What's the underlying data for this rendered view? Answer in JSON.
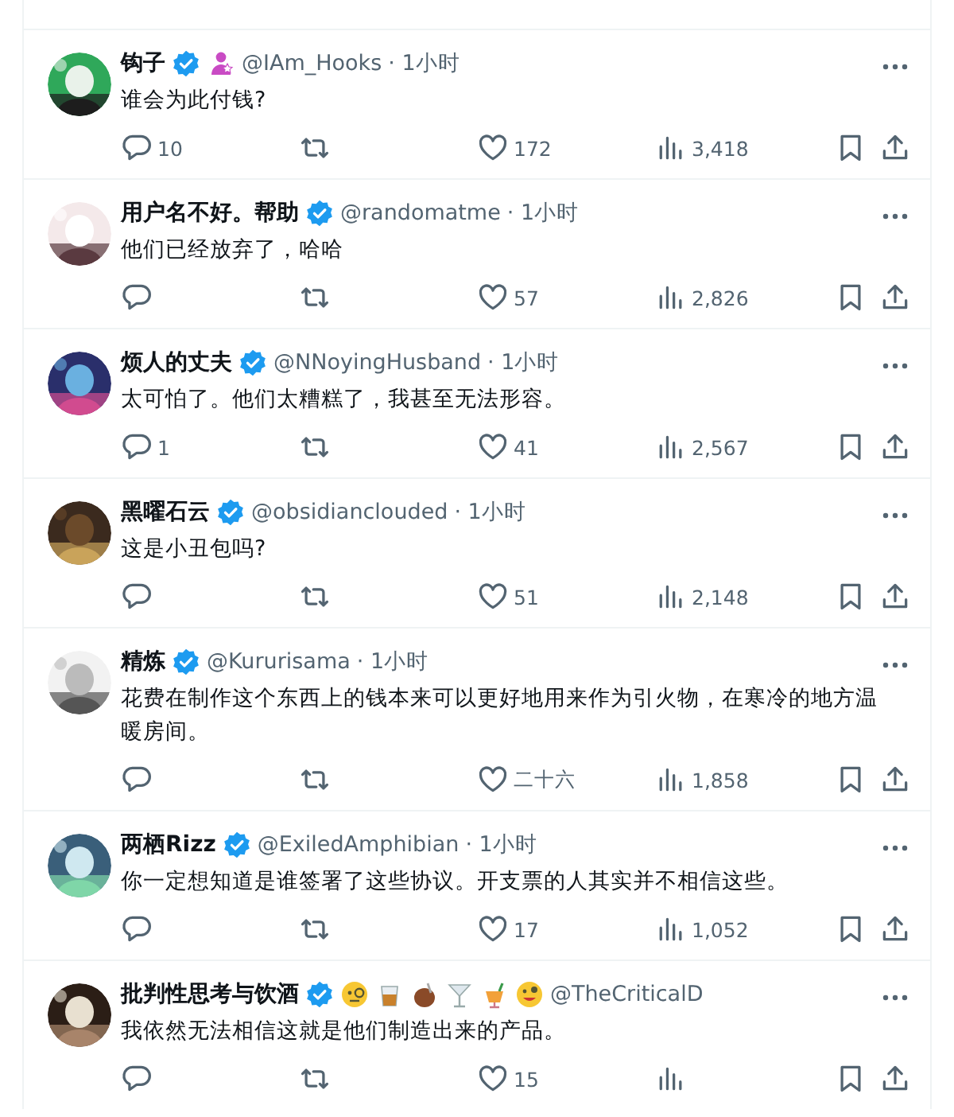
{
  "posts": [
    {
      "name": "钩子",
      "verified": true,
      "badges": [
        {
          "kind": "affiliate"
        }
      ],
      "handle": "@IAm_Hooks",
      "time": "· 1小时",
      "text": "谁会为此付钱?",
      "replies": "10",
      "likes": "172",
      "views": "3,418",
      "avatar": {
        "kind": "picture"
      }
    },
    {
      "name": "用户名不好。帮助",
      "verified": true,
      "handle": "@randomatme",
      "time": "· 1小时",
      "text": "他们已经放弃了，哈哈",
      "likes": "57",
      "views": "2,826",
      "avatar": {
        "kind": "picture"
      }
    },
    {
      "name": "烦人的丈夫",
      "verified": true,
      "handle": "@NNoyingHusband",
      "time": "· 1小时",
      "text": "太可怕了。他们太糟糕了，我甚至无法形容。",
      "replies": "1",
      "likes": "41",
      "views": "2,567",
      "avatar": {
        "kind": "picture"
      }
    },
    {
      "name": "黑曜石云",
      "verified": true,
      "handle": "@obsidianclouded",
      "time": "· 1小时",
      "text": "这是小丑包吗?",
      "likes": "51",
      "views": "2,148",
      "avatar": {
        "kind": "picture"
      }
    },
    {
      "name": "精炼",
      "verified": true,
      "handle": "@Kururisama",
      "time": "· 1小时",
      "text": "花费在制作这个东西上的钱本来可以更好地用来作为引火物，在寒冷的地方温暖房间。",
      "likes": "二十六",
      "views": "1,858",
      "avatar": {
        "kind": "picture"
      }
    },
    {
      "name": "两栖Rizz",
      "verified": true,
      "handle": "@ExiledAmphibian",
      "time": "· 1小时",
      "text": "你一定想知道是谁签署了这些协议。开支票的人其实并不相信这些。",
      "likes": "17",
      "views": "1,052",
      "avatar": {
        "kind": "picture"
      }
    },
    {
      "name": "批判性思考与饮酒",
      "verified": true,
      "badges": [
        {
          "kind": "monocle-face"
        },
        {
          "kind": "whisky-glass"
        },
        {
          "kind": "gourd-cup"
        },
        {
          "kind": "cocktail-glass"
        },
        {
          "kind": "tropical-drink"
        },
        {
          "kind": "zany-face"
        }
      ],
      "handle": "@TheCriticalD",
      "text": "我依然无法相信这就是他们制造出来的产品。",
      "likes": "15",
      "avatar": {
        "kind": "picture"
      }
    }
  ]
}
